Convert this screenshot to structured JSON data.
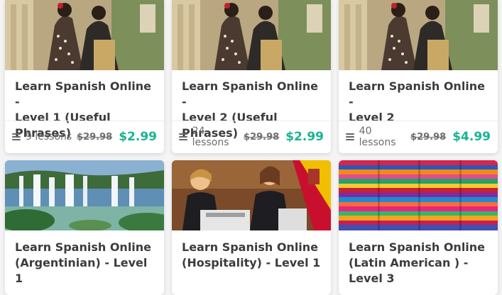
{
  "courses": [
    {
      "title_line1": "Learn Spanish Online -",
      "title_line2": "Level 1 (Useful Phrases)",
      "lessons": "9 lessons",
      "old_price": "$29.98",
      "new_price": "$2.99",
      "image": "flamenco-dancers"
    },
    {
      "title_line1": "Learn Spanish Online -",
      "title_line2": "Level 2 (Useful Phrases)",
      "lessons": "24 lessons",
      "old_price": "$29.98",
      "new_price": "$2.99",
      "image": "flamenco-dancers"
    },
    {
      "title_line1": "Learn Spanish Online -",
      "title_line2": "Level 2",
      "lessons": "40 lessons",
      "old_price": "$29.98",
      "new_price": "$4.99",
      "image": "flamenco-dancers"
    },
    {
      "title_line1": "Learn Spanish Online",
      "title_line2": "(Argentinian) - Level 1",
      "image": "iguazu-waterfall"
    },
    {
      "title_line1": "Learn Spanish Online",
      "title_line2": "(Hospitality) - Level 1",
      "image": "hotel-reception"
    },
    {
      "title_line1": "Learn Spanish Online",
      "title_line2": "(Latin American ) -",
      "title_line3": "Level 3",
      "image": "colorful-textiles"
    }
  ],
  "colors": {
    "price_accent": "#19b491",
    "title_text": "#3c3c3c"
  }
}
